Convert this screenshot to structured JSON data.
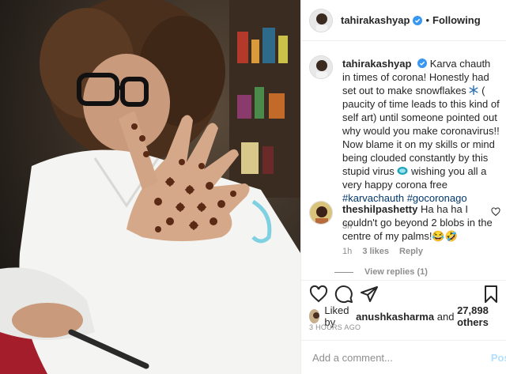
{
  "post": {
    "username": "tahirakashyap",
    "follow_status": "Following",
    "separator": "•"
  },
  "caption": {
    "username": "tahirakashyap",
    "text_before_icon": "Karva chauth in times of corona! Honestly had set out to make snowflakes",
    "text_after_icon": "( paucity of time leads to this kind of self art) until someone pointed out why would you make coronavirus!! Now blame it on my skills or mind being clouded constantly by this stupid virus",
    "text_end": "wishing you all a very happy corona free",
    "hashtag1": "#karvachauth",
    "hashtag2": "#gocoronago",
    "time": "3h"
  },
  "comment": {
    "username": "theshilpashetty",
    "text": "Ha ha ha I couldn't go beyond 2 blobs in the centre of my palms!😂🤣",
    "time": "1h",
    "likes": "3 likes",
    "reply": "Reply",
    "view_replies": "View replies (1)"
  },
  "likes": {
    "prefix": "Liked by",
    "user": "anushkasharma",
    "and": "and",
    "others": "27,898 others"
  },
  "timestamp": "3 HOURS AGO",
  "add_comment": {
    "placeholder": "Add a comment...",
    "post_label": "Post"
  },
  "icons": {
    "verified": "verified-badge-icon",
    "heart": "heart-icon",
    "comment": "comment-icon",
    "share": "share-icon",
    "save": "bookmark-icon",
    "snowflake": "snowflake-emoji-icon",
    "mask": "face-mask-emoji-icon"
  },
  "colors": {
    "verified": "#3897f0",
    "link": "#00376b",
    "muted": "#8e8e8e",
    "post_button": "#b2dffc"
  }
}
